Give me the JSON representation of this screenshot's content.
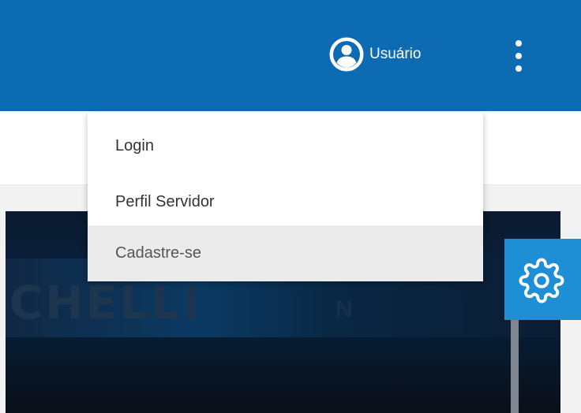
{
  "header": {
    "user_label": "Usuário",
    "user_icon": "user-circle-icon",
    "more_icon": "more-vertical-icon",
    "accent_color": "#0c6bb3"
  },
  "user_menu": {
    "items": [
      {
        "label": "Login"
      },
      {
        "label": "Perfil Servidor"
      },
      {
        "label": "Cadastre-se",
        "state": "hover"
      }
    ]
  },
  "hero": {
    "banner_text": "ICHELLI",
    "mark": "N"
  },
  "settings_button": {
    "icon": "gear-icon",
    "color": "#1e8fd5"
  }
}
